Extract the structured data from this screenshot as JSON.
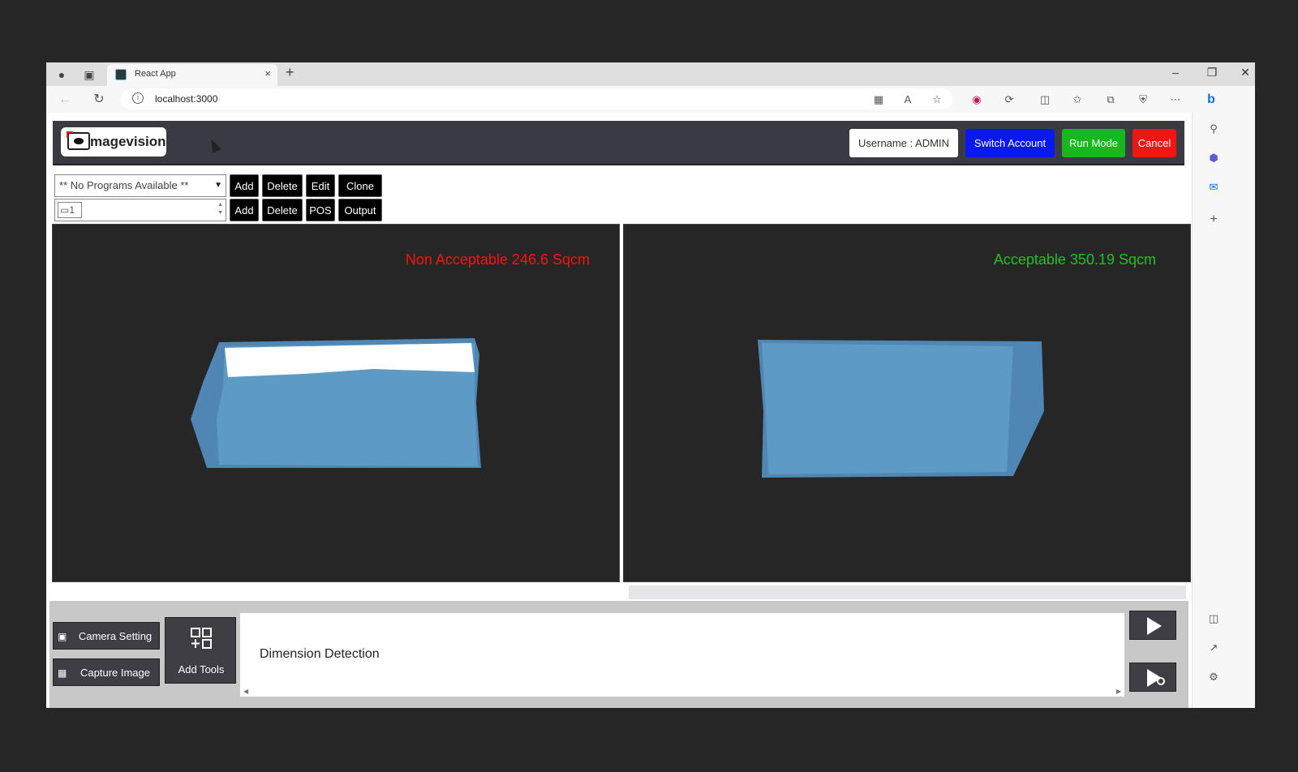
{
  "browser": {
    "tab_title": "React App",
    "url": "localhost:3000",
    "new_tab": "+",
    "tab_close": "×"
  },
  "header": {
    "logo_text": "magevision",
    "username_label": "Username : ADMIN",
    "switch_label": "Switch Account",
    "run_label": "Run Mode",
    "cancel_label": "Cancel",
    "colors": {
      "switch": "#0a18f0",
      "run": "#16b81e",
      "cancel": "#f01616"
    }
  },
  "program_row": {
    "select_value": "** No Programs Available **",
    "buttons": [
      "Add",
      "Delete",
      "Edit",
      "Clone"
    ]
  },
  "camera_row": {
    "camera_value": "1",
    "buttons": [
      "Add",
      "Delete",
      "POS",
      "Output"
    ]
  },
  "panels": {
    "left_label": "Non Acceptable 246.6 Sqcm",
    "right_label": "Acceptable 350.19 Sqcm",
    "colors": {
      "bad": "#ff1010",
      "good": "#22c022",
      "object": "#5d9ac4"
    }
  },
  "bottom": {
    "camera_setting": "Camera Setting",
    "capture_image": "Capture Image",
    "add_tools": "Add Tools",
    "tool_item": "Dimension Detection"
  },
  "icons": [
    "user-icon",
    "workspaces-icon",
    "back-icon",
    "refresh-icon",
    "info-icon",
    "grid-icon",
    "read-aloud-icon",
    "favorite-icon",
    "extension-icon",
    "split-icon",
    "favorites-icon",
    "collections-icon",
    "shield-icon",
    "more-icon",
    "bing-icon",
    "search-icon",
    "copilot-icon",
    "outlook-icon",
    "plus-icon",
    "sidebar-icon",
    "external-icon",
    "settings-icon",
    "camera-icon",
    "image-icon",
    "add-tools-icon",
    "play-icon",
    "play-settings-icon"
  ]
}
